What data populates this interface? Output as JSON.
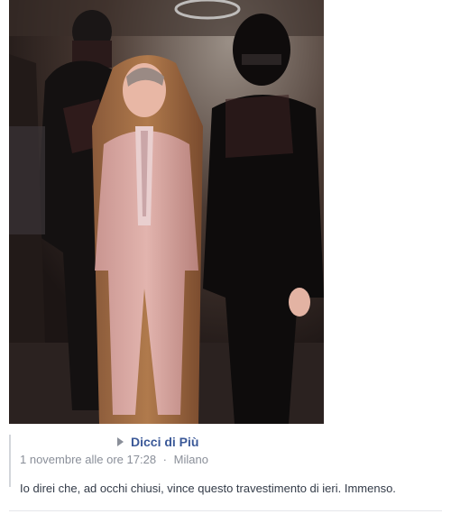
{
  "post": {
    "author": "Dicci di Più",
    "date": "1 novembre alle ore 17:28",
    "separator": "·",
    "location": "Milano",
    "text": "Io direi che, ad occhi chiusi, vince questo travestimento di ieri. Immenso."
  },
  "photo": {
    "description_icon": "photo-icon"
  },
  "colors": {
    "link": "#3b5998",
    "meta": "#8a8f99",
    "body_text": "#333b48"
  }
}
